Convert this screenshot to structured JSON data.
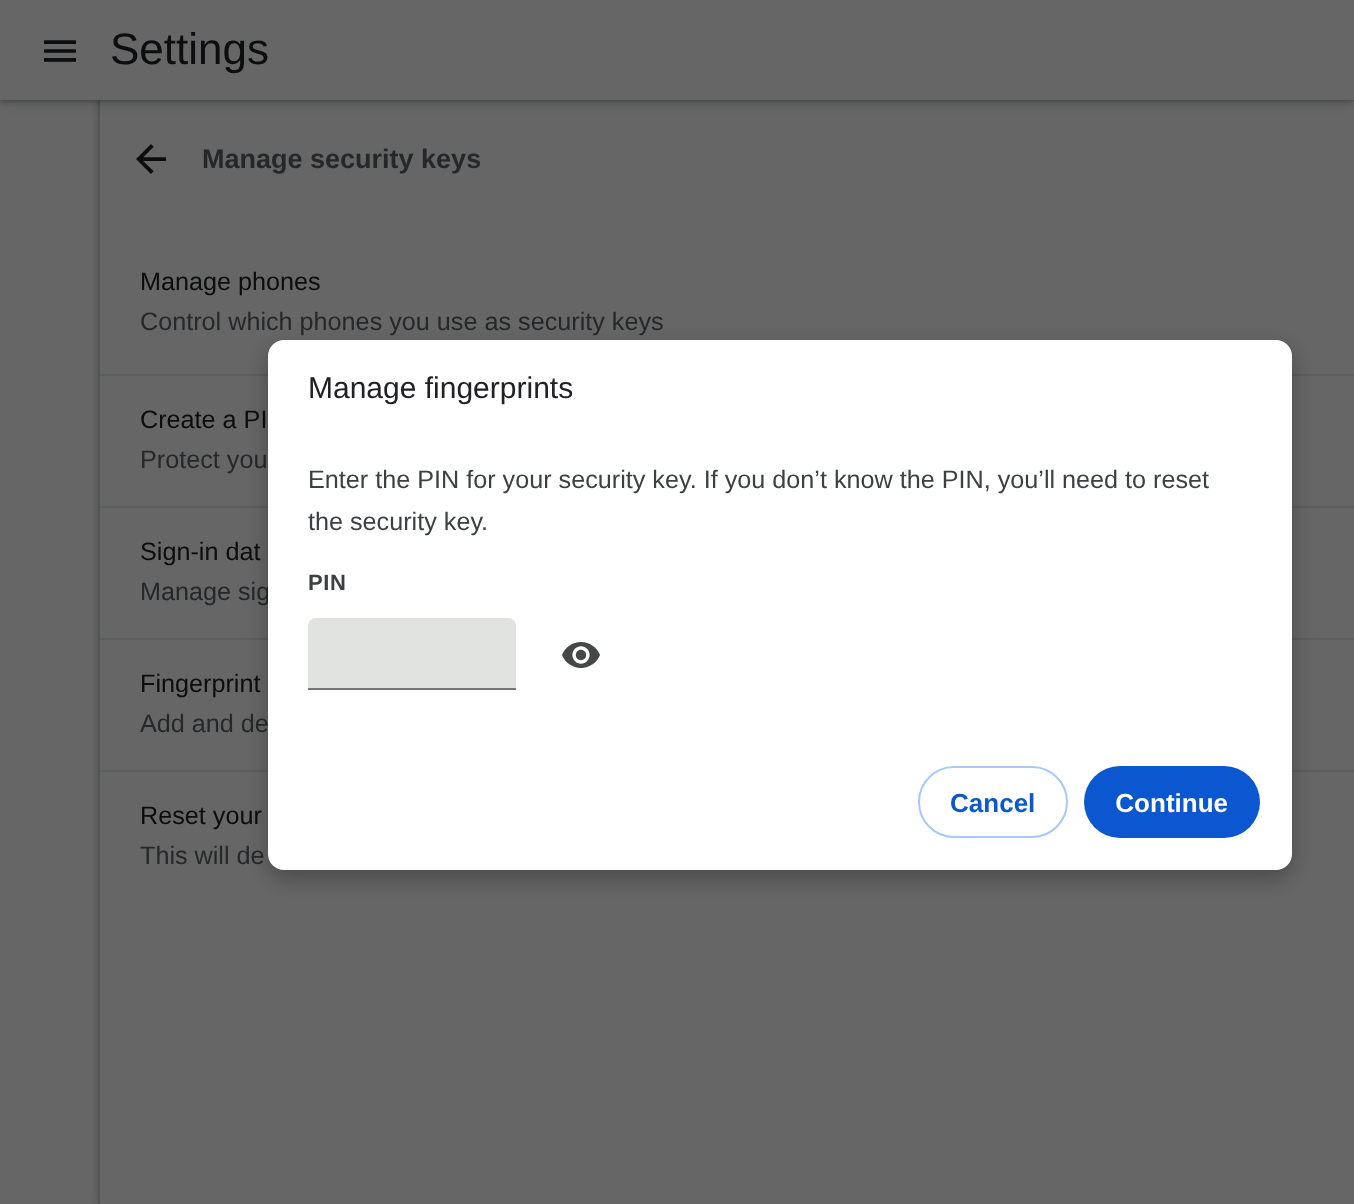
{
  "top_bar": {
    "title": "Settings"
  },
  "subpage": {
    "title": "Manage security keys"
  },
  "rows": [
    {
      "title": "Manage phones",
      "description": "Control which phones you use as security keys"
    },
    {
      "title": "Create a PI",
      "description": "Protect you"
    },
    {
      "title": "Sign-in dat",
      "description": "Manage sig"
    },
    {
      "title": "Fingerprint",
      "description": "Add and de"
    },
    {
      "title": "Reset your",
      "description": "This will de"
    }
  ],
  "dialog": {
    "title": "Manage fingerprints",
    "message": "Enter the PIN for your security key. If you don’t know the PIN, you’ll need to reset the security key.",
    "field": {
      "label": "PIN"
    },
    "buttons": [
      {
        "label": "Cancel",
        "kind": "outlined"
      },
      {
        "label": "Continue",
        "kind": "filled"
      }
    ]
  }
}
